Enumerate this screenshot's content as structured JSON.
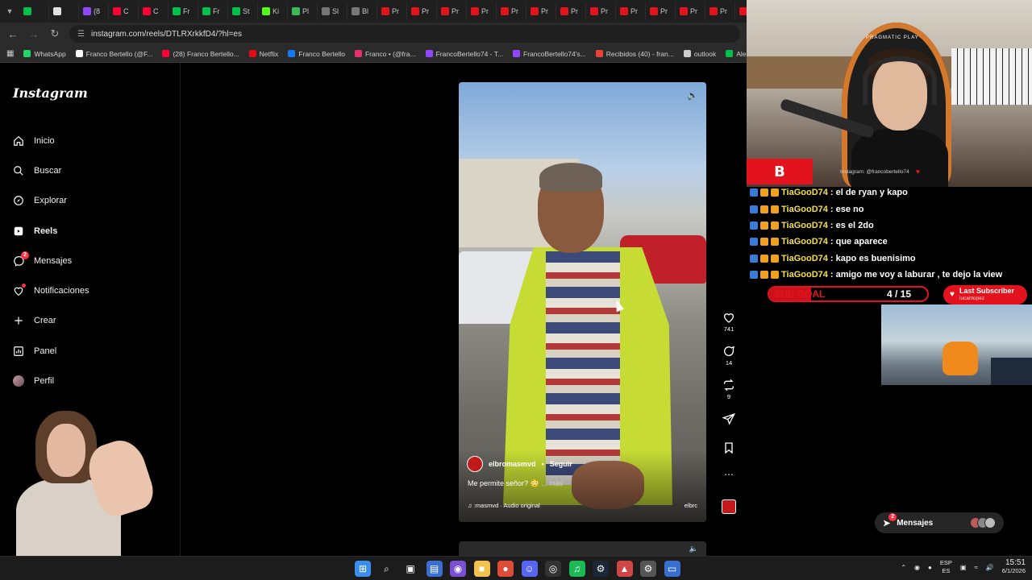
{
  "browser": {
    "tabs": [
      {
        "label": "",
        "color": "#00c24a"
      },
      {
        "label": "",
        "color": "#e0e0e0"
      },
      {
        "label": "(8",
        "color": "#9146ff"
      },
      {
        "label": "C",
        "color": "#ff0033"
      },
      {
        "label": "C",
        "color": "#ff0033"
      },
      {
        "label": "Fr",
        "color": "#00c24a"
      },
      {
        "label": "Fr",
        "color": "#00c24a"
      },
      {
        "label": "St",
        "color": "#00c24a"
      },
      {
        "label": "Ki",
        "color": "#53fc18"
      },
      {
        "label": "Pl",
        "color": "#3cba54"
      },
      {
        "label": "Sl",
        "color": "#777777"
      },
      {
        "label": "Bl",
        "color": "#777777"
      },
      {
        "label": "Pr",
        "color": "#e3131e"
      },
      {
        "label": "Pr",
        "color": "#e3131e"
      },
      {
        "label": "Pr",
        "color": "#e3131e"
      },
      {
        "label": "Pr",
        "color": "#e3131e"
      },
      {
        "label": "Pr",
        "color": "#e3131e"
      },
      {
        "label": "Pr",
        "color": "#e3131e"
      },
      {
        "label": "Pr",
        "color": "#e3131e"
      },
      {
        "label": "Pr",
        "color": "#e3131e"
      },
      {
        "label": "Pr",
        "color": "#e3131e"
      },
      {
        "label": "Pr",
        "color": "#e3131e"
      },
      {
        "label": "Pr",
        "color": "#e3131e"
      },
      {
        "label": "Pr",
        "color": "#e3131e"
      },
      {
        "label": "",
        "color": "#e3131e"
      }
    ],
    "url": "instagram.com/reels/DTLRXrkkfD4/?hl=es",
    "bookmarks": [
      {
        "label": "WhatsApp",
        "color": "#25d366"
      },
      {
        "label": "Franco Bertello (@F...",
        "color": "#ffffff"
      },
      {
        "label": "(28) Franco Bertello...",
        "color": "#ff0033"
      },
      {
        "label": "Netflix",
        "color": "#e50914"
      },
      {
        "label": "Franco Bertello",
        "color": "#1877f2"
      },
      {
        "label": "Franco • (@fra...",
        "color": "#e1306c"
      },
      {
        "label": "FrancoBertello74 - T...",
        "color": "#9146ff"
      },
      {
        "label": "FrancoBertello74's...",
        "color": "#9146ff"
      },
      {
        "label": "Recibidos (40) - fran...",
        "color": "#ea4335"
      },
      {
        "label": "outlook",
        "color": "#cccccc"
      },
      {
        "label": "Aler",
        "color": "#00c24a"
      }
    ]
  },
  "instagram": {
    "logo": "Instagram",
    "nav": [
      {
        "label": "Inicio",
        "icon": "home-icon"
      },
      {
        "label": "Buscar",
        "icon": "search-icon"
      },
      {
        "label": "Explorar",
        "icon": "compass-icon"
      },
      {
        "label": "Reels",
        "icon": "reels-icon"
      },
      {
        "label": "Mensajes",
        "icon": "messenger-icon",
        "badge": "2"
      },
      {
        "label": "Notificaciones",
        "icon": "heart-icon"
      },
      {
        "label": "Crear",
        "icon": "plus-icon"
      },
      {
        "label": "Panel",
        "icon": "chart-icon"
      },
      {
        "label": "Perfil",
        "icon": "avatar-icon"
      }
    ],
    "reel": {
      "username": "elbromasmvd",
      "separator": "•",
      "follow": "Seguir",
      "caption": "Me permite señor? 😳",
      "more": "... más",
      "audio": "♫ :masmvd · Audio original",
      "audio_right": "elbrc"
    },
    "actions": {
      "likes": "741",
      "comments": "14",
      "reposts": "9"
    }
  },
  "stream": {
    "cam_brand": "PRAGMATIC PLAY",
    "chat_logo": "B",
    "instagram_handle": "Instagram: @francobertello74",
    "chat": [
      {
        "user": "TiaGooD74",
        "text": ": el de ryan y kapo"
      },
      {
        "user": "TiaGooD74",
        "text": ": ese no"
      },
      {
        "user": "TiaGooD74",
        "text": ": es el 2do"
      },
      {
        "user": "TiaGooD74",
        "text": ": que aparece"
      },
      {
        "user": "TiaGooD74",
        "text": ": kapo es buenisimo"
      },
      {
        "user": "TiaGooD74",
        "text": ": amigo me voy a laburar , te dejo la view"
      }
    ],
    "subgoal": {
      "label": "SUB GOAL",
      "current": 4,
      "target": 15,
      "value": "4 / 15"
    },
    "last_subscriber": {
      "title": "Last Subscriber",
      "name": "lucanlopez"
    },
    "messages_pill": {
      "label": "Mensajes",
      "badge": "2"
    }
  },
  "taskbar": {
    "apps": [
      "windows-start-icon",
      "search-icon",
      "task-view-icon",
      "store-icon",
      "tor-icon",
      "file-explorer-icon",
      "chrome-icon",
      "discord-icon",
      "obs-icon",
      "spotify-icon",
      "steam-icon",
      "vpn-icon",
      "settings-icon",
      "display-icon"
    ],
    "lang_top": "ESP",
    "lang_bottom": "ES",
    "time": "15:51",
    "date": "6/1/2026"
  }
}
